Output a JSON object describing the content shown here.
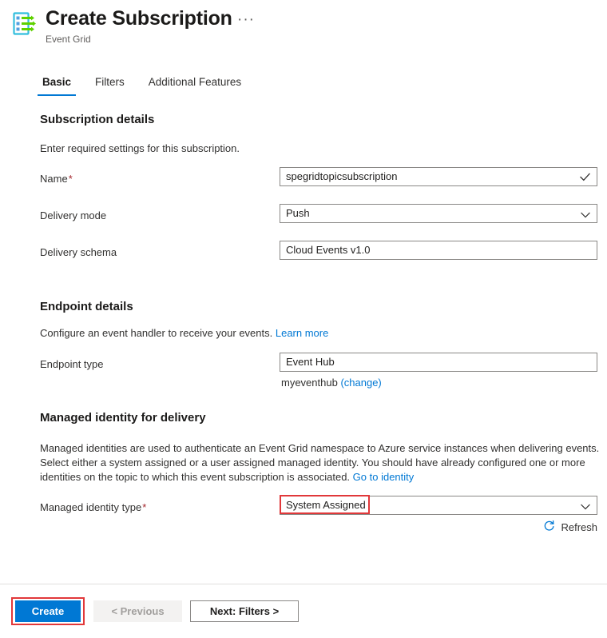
{
  "header": {
    "icon": "event-grid-subscription-icon",
    "title": "Create Subscription",
    "subtitle": "Event Grid",
    "more_actions": "···"
  },
  "tabs": [
    {
      "label": "Basic",
      "active": true
    },
    {
      "label": "Filters",
      "active": false
    },
    {
      "label": "Additional Features",
      "active": false
    }
  ],
  "sections": {
    "subscription_details": {
      "title": "Subscription details",
      "description": "Enter required settings for this subscription.",
      "fields": {
        "name": {
          "label": "Name",
          "required": "*",
          "value": "spegridtopicsubscription",
          "validation_icon": "checkmark-icon"
        },
        "delivery_mode": {
          "label": "Delivery mode",
          "value": "Push",
          "icon": "chevron-down-icon"
        },
        "delivery_schema": {
          "label": "Delivery schema",
          "value": "Cloud Events v1.0"
        }
      }
    },
    "endpoint_details": {
      "title": "Endpoint details",
      "description": "Configure an event handler to receive your events.",
      "description_link": "Learn more",
      "fields": {
        "endpoint_type": {
          "label": "Endpoint type",
          "value": "Event Hub",
          "note": "myeventhub",
          "note_link": "(change)"
        }
      }
    },
    "managed_identity": {
      "title": "Managed identity for delivery",
      "description_line1": "Managed identities are used to authenticate an Event Grid namespace to Azure service instances when delivering events.",
      "description_line2": "Select either a system assigned or a user assigned managed identity. You should have already configured one or more",
      "description_line3": "identities on the topic to which this event subscription is associated.",
      "description_link": "Go to identity",
      "fields": {
        "identity_type": {
          "label": "Managed identity type",
          "required": "*",
          "value": "System Assigned",
          "icon": "chevron-down-icon",
          "highlighted": true
        }
      },
      "refresh": {
        "label": "Refresh",
        "icon": "refresh-icon"
      }
    }
  },
  "footer": {
    "create_label": "Create",
    "previous_label": "< Previous",
    "next_label": "Next: Filters >",
    "create_highlighted": true
  },
  "colors": {
    "accent": "#0078d4",
    "link": "#0078d4",
    "required": "#a4262c",
    "highlight": "#e1383a",
    "border": "#8a8886",
    "text": "#323130"
  }
}
